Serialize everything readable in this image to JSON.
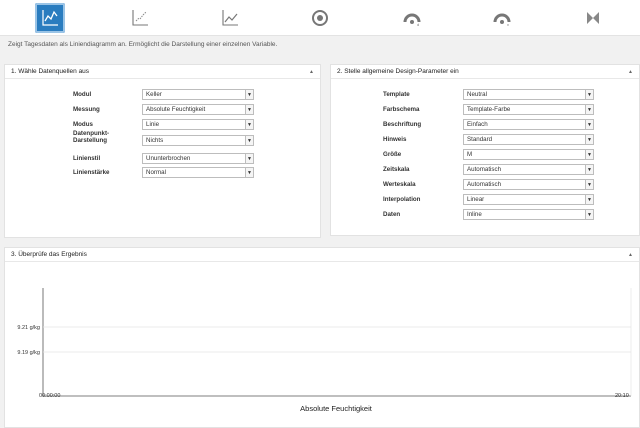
{
  "toolbar": {
    "buttons": [
      {
        "icon": "line-chart-icon",
        "active": true
      },
      {
        "icon": "scatter-chart-icon",
        "active": false
      },
      {
        "icon": "area-chart-icon",
        "active": false
      },
      {
        "icon": "gauge-icon",
        "active": false
      },
      {
        "icon": "dial-d-icon",
        "active": false
      },
      {
        "icon": "dial-v-icon",
        "active": false
      },
      {
        "icon": "bowtie-icon",
        "active": false
      }
    ]
  },
  "hint": "Zeigt Tagesdaten als Liniendiagramm an. Ermöglicht die Darstellung einer einzelnen Variable.",
  "panel1": {
    "title": "1. Wähle Datenquellen aus",
    "fields": [
      {
        "label": "Modul",
        "value": "Keller"
      },
      {
        "label": "Messung",
        "value": "Absolute Feuchtigkeit"
      },
      {
        "label": "Modus",
        "value": "Linie"
      },
      {
        "label": "Datenpunkt-\nDarstellung",
        "value": "Nichts"
      },
      {
        "label": "Linienstil",
        "value": "Ununterbrochen"
      },
      {
        "label": "Linienstärke",
        "value": "Normal"
      }
    ]
  },
  "panel2": {
    "title": "2. Stelle allgemeine Design-Parameter ein",
    "fields": [
      {
        "label": "Template",
        "value": "Neutral"
      },
      {
        "label": "Farbschema",
        "value": "Template-Farbe"
      },
      {
        "label": "Beschriftung",
        "value": "Einfach"
      },
      {
        "label": "Hinweis",
        "value": "Standard"
      },
      {
        "label": "Größe",
        "value": "M"
      },
      {
        "label": "Zeitskala",
        "value": "Automatisch"
      },
      {
        "label": "Werteskala",
        "value": "Automatisch"
      },
      {
        "label": "Interpolation",
        "value": "Linear"
      },
      {
        "label": "Daten",
        "value": "Inline"
      }
    ]
  },
  "panel3": {
    "title": "3. Überprüfe das Ergebnis"
  },
  "chart_data": {
    "type": "line",
    "xlabel": "Absolute Feuchtigkeit",
    "y_ticks": [
      "9.21 g/kg",
      "9.19 g/kg"
    ],
    "x_ticks": [
      "00:00:00",
      "20:10"
    ],
    "series": [
      {
        "values": []
      }
    ]
  }
}
